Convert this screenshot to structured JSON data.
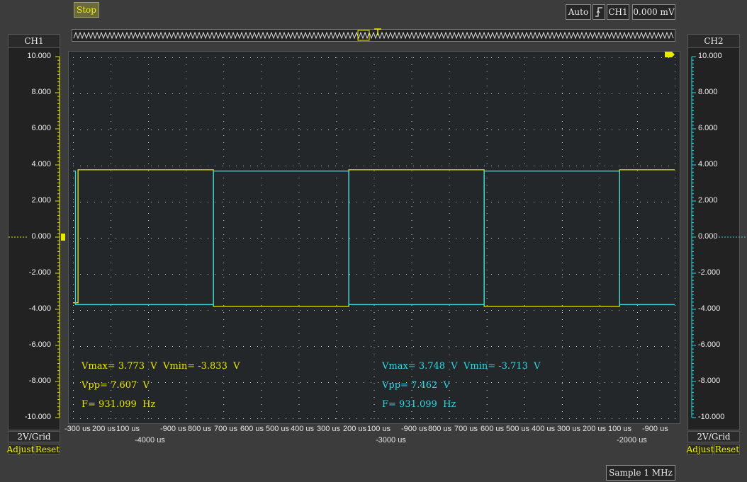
{
  "toolbar": {
    "stop_label": "Stop",
    "trigger_mode": "Auto",
    "trigger_channel": "CH1",
    "trigger_level": "0.000 mV",
    "sample_rate": "Sample 1 MHz"
  },
  "ch1": {
    "title": "CH1",
    "scale": "2V/Grid",
    "adjust": "Adjust",
    "reset": "Reset",
    "ticks": [
      "10.000",
      "8.000",
      "6.000",
      "4.000",
      "2.000",
      "0.000",
      "-2.000",
      "-4.000",
      "-6.000",
      "-8.000",
      "-10.000"
    ],
    "color": "#e8e800",
    "measurements": {
      "vmax_vmin": "Vmax= 3.773  V  Vmin= -3.833  V",
      "vpp": "Vpp= 7.607  V",
      "freq": "F= 931.099  Hz"
    }
  },
  "ch2": {
    "title": "CH2",
    "scale": "2V/Grid",
    "adjust": "Adjust",
    "reset": "Reset",
    "ticks": [
      "10.000",
      "8.000",
      "6.000",
      "4.000",
      "2.000",
      "0.000",
      "-2.000",
      "-4.000",
      "-6.000",
      "-8.000",
      "-10.000"
    ],
    "color": "#30d8e8",
    "measurements": {
      "vmax_vmin": "Vmax= 3.748  V  Vmin= -3.713  V",
      "vpp": "Vpp= 7.462  V",
      "freq": "F= 931.099  Hz"
    }
  },
  "x_axis": {
    "upper_labels": [
      "-300 us",
      "200 us",
      "100 us",
      "-900 us",
      "800 us",
      "700 us",
      "600 us",
      "500 us",
      "400 us",
      "300 us",
      "200 us",
      "100 us",
      "-900 us",
      "800 us",
      "700 us",
      "600 us",
      "500 us",
      "400 us",
      "300 us",
      "200 us",
      "100 us",
      "-900 us"
    ],
    "lower_labels": [
      "-4000 us",
      "-3000 us",
      "-2000 us"
    ]
  },
  "chart_data": {
    "type": "line",
    "ylim": [
      -10,
      10
    ],
    "xlim": [
      -4300,
      -1900
    ],
    "xlabel": "",
    "ylabel": "",
    "grid": true,
    "series": [
      {
        "name": "CH1",
        "color": "#e8e800",
        "x": [
          -4300,
          -4280,
          -4280,
          -3740,
          -3740,
          -3200,
          -3200,
          -2660,
          -2660,
          -2120,
          -2120,
          -1900
        ],
        "values": [
          -3.6,
          -3.6,
          3.77,
          3.77,
          -3.8,
          -3.8,
          3.77,
          3.77,
          -3.8,
          -3.8,
          3.77,
          3.77
        ]
      },
      {
        "name": "CH2",
        "color": "#30d8e8",
        "x": [
          -4300,
          -4290,
          -4290,
          -4270,
          -4270,
          -3740,
          -3740,
          -3200,
          -3200,
          -2660,
          -2660,
          -2120,
          -2120,
          -1900
        ],
        "values": [
          3.7,
          3.7,
          -3.7,
          -3.7,
          -3.7,
          -3.7,
          3.7,
          3.7,
          -3.7,
          -3.7,
          3.7,
          3.7,
          -3.7,
          -3.7
        ]
      }
    ]
  }
}
